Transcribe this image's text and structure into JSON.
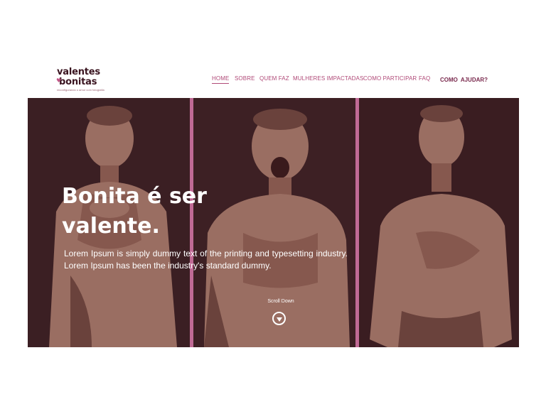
{
  "logo": {
    "line1": "valentes",
    "line2": "bonitas",
    "tagline": "reconfigurando o amor com fotografia",
    "icon": "heart-icon"
  },
  "nav": {
    "items": [
      "HOME",
      "SOBRE",
      "QUEM FAZ",
      "MULHERES IMPACTADAS",
      "COMO PARTICIPAR",
      "FAQ"
    ],
    "active": "HOME",
    "cta": "COMO AJUDAR?"
  },
  "hero": {
    "title_line1": "Bonita é ser",
    "title_line2": "valente.",
    "text": "Lorem Ipsum is simply dummy text of the printing and typesetting industry. Lorem Ipsum has been the industry's standard dummy.",
    "scroll_label": "Scroll Down",
    "scroll_icon": "chevron-down-icon"
  },
  "colors": {
    "accent": "#b04a78",
    "separator": "#c06a95",
    "hero_bg": "#3a1e22",
    "logo_text": "#3a1420"
  }
}
